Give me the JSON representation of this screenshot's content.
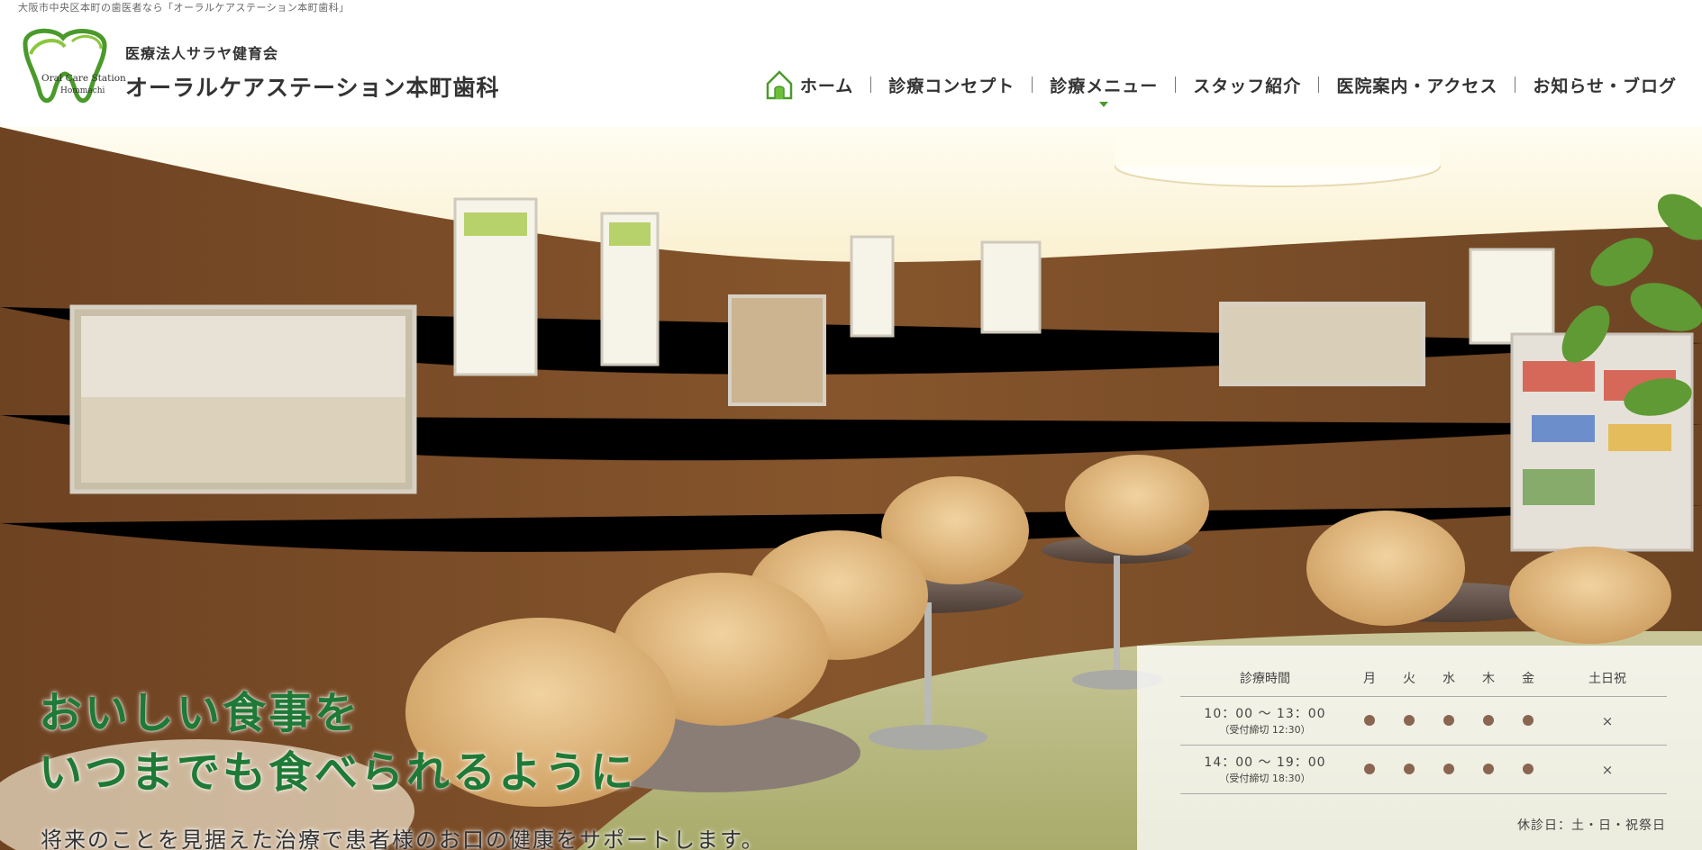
{
  "top_strip": {
    "text": "大阪市中央区本町の歯医者なら「オーラルケアステーション本町歯科」"
  },
  "logo": {
    "line1": "Oral Care Station",
    "line2": "Hommachi",
    "color": "#4a9a2b"
  },
  "header": {
    "org_name": "医療法人サラヤ健育会",
    "clinic_name": "オーラルケアステーション本町歯科"
  },
  "nav": {
    "items": [
      {
        "label": "ホーム",
        "icon": "home-icon"
      },
      {
        "label": "診療コンセプト"
      },
      {
        "label": "診療メニュー",
        "has_dropdown": true
      },
      {
        "label": "スタッフ紹介"
      },
      {
        "label": "医院案内・アクセス"
      },
      {
        "label": "お知らせ・ブログ"
      }
    ]
  },
  "hero": {
    "catch_line1": "おいしい食事を",
    "catch_line2": "いつまでも食べられるように",
    "subcatch": "将来のことを見据えた治療で患者様のお口の健康をサポートします。",
    "catch_color": "#1e7a36"
  },
  "hours": {
    "headers": [
      "診療時間",
      "月",
      "火",
      "水",
      "木",
      "金",
      "土日祝"
    ],
    "rows": [
      {
        "time": "10：00 〜 13：00",
        "note": "（受付締切 12:30）",
        "days": [
          "open",
          "open",
          "open",
          "open",
          "open",
          "closed"
        ]
      },
      {
        "time": "14：00 〜 19：00",
        "note": "（受付締切 18:30）",
        "days": [
          "open",
          "open",
          "open",
          "open",
          "open",
          "closed"
        ]
      }
    ],
    "closed_mark": "×",
    "closed_days": "休診日：土・日・祝祭日",
    "dot_color": "#8a6552"
  }
}
